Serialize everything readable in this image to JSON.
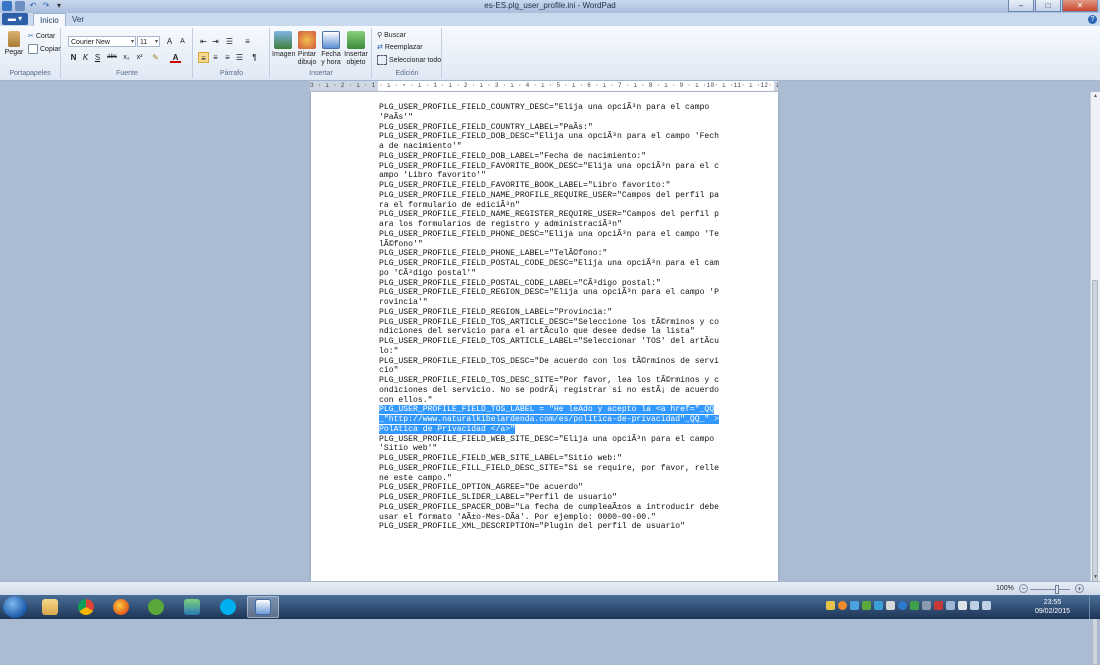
{
  "window": {
    "title": "es-ES.plg_user_profile.ini - WordPad",
    "min_label": "–",
    "max_label": "□",
    "close_label": "✕"
  },
  "ribbon": {
    "app_menu_label": "▬ ▾",
    "tabs": [
      {
        "label": "Inicio",
        "active": true
      },
      {
        "label": "Ver",
        "active": false
      }
    ],
    "help_label": "?",
    "clipboard": {
      "paste_label": "Pegar",
      "cut_label": "Cortar",
      "copy_label": "Copiar",
      "group_label": "Portapapeles"
    },
    "font": {
      "family": "Courier New",
      "size": "11",
      "grow_label": "A",
      "shrink_label": "A",
      "bold": "N",
      "italic": "K",
      "underline": "S",
      "strike": "abc",
      "subscript": "x₂",
      "superscript": "x²",
      "highlight_label": "✎",
      "color_label": "A",
      "group_label": "Fuente"
    },
    "paragraph": {
      "group_label": "Párrafo"
    },
    "insert": {
      "image_label": "Imagen",
      "paint_label": "Pintar dibujo",
      "datetime_label": "Fecha y hora",
      "object_label": "Insertar objeto",
      "group_label": "Insertar"
    },
    "edit": {
      "find_label": "Buscar",
      "replace_label": "Reemplazar",
      "select_all_label": "Seleccionar todo",
      "group_label": "Edición"
    }
  },
  "ruler": {
    "labels": "3 · ı · 2 · ı · 1 · ı · ▿ · ı · 1 · ı · 2 · ı · 3 · ı · 4 · ı · 5 · ı · 6 · ı · 7 · ı · 8 · ı · 9 · ı ·10· ı ·11· ı ·12· ı ·13· ı ·14·ı ·15· ı ·16· ı ·17· ı ·18"
  },
  "document": {
    "before_selection": "PLG_USER_PROFILE_FIELD_COUNTRY_DESC=\"Elija una opciÃ³n para el campo 'PaÃ­s'\"\nPLG_USER_PROFILE_FIELD_COUNTRY_LABEL=\"PaÃ­s:\"\nPLG_USER_PROFILE_FIELD_DOB_DESC=\"Elija una opciÃ³n para el campo 'Fecha de nacimiento'\"\nPLG_USER_PROFILE_FIELD_DOB_LABEL=\"Fecha de nacimiento:\"\nPLG_USER_PROFILE_FIELD_FAVORITE_BOOK_DESC=\"Elija una opciÃ³n para el campo 'Libro favorito'\"\nPLG_USER_PROFILE_FIELD_FAVORITE_BOOK_LABEL=\"Libro favorito:\"\nPLG_USER_PROFILE_FIELD_NAME_PROFILE_REQUIRE_USER=\"Campos del perfil para el formulario de ediciÃ³n\"\nPLG_USER_PROFILE_FIELD_NAME_REGISTER_REQUIRE_USER=\"Campos del perfil para los formularios de registro y administraciÃ³n\"\nPLG_USER_PROFILE_FIELD_PHONE_DESC=\"Elija una opciÃ³n para el campo 'TelÃ©fono'\"\nPLG_USER_PROFILE_FIELD_PHONE_LABEL=\"TelÃ©fono:\"\nPLG_USER_PROFILE_FIELD_POSTAL_CODE_DESC=\"Elija una opciÃ³n para el campo 'CÃ³digo postal'\"\nPLG_USER_PROFILE_FIELD_POSTAL_CODE_LABEL=\"CÃ³digo postal:\"\nPLG_USER_PROFILE_FIELD_REGION_DESC=\"Elija una opciÃ³n para el campo 'Provincia'\"\nPLG_USER_PROFILE_FIELD_REGION_LABEL=\"Provincia:\"\nPLG_USER_PROFILE_FIELD_TOS_ARTICLE_DESC=\"Seleccione los tÃ©rminos y condiciones del servicio para el artÃ­culo que desee dedse la lista\"\nPLG_USER_PROFILE_FIELD_TOS_ARTICLE_LABEL=\"Seleccionar 'TOS' del artÃ­culo:\"\nPLG_USER_PROFILE_FIELD_TOS_DESC=\"De acuerdo con los tÃ©rminos de servicio\"\nPLG_USER_PROFILE_FIELD_TOS_DESC_SITE=\"Por favor, lea los tÃ©rminos y condiciones del servicio. No se podrÃ¡ registrar si no estÃ¡ de acuerdo con ellos.\"\n",
    "selection": "PLG_USER_PROFILE_FIELD_TOS_LABEL = \"He leÃ­do y acepto la <a href=\"_QQ_\"http://www.naturalkibelardenda.com/es/politica-de-privacidad\"_QQ_\" >PolÃ­tica de Privacidad </a>\"",
    "after_selection": "\nPLG_USER_PROFILE_FIELD_WEB_SITE_DESC=\"Elija una opciÃ³n para el campo 'Sitio web'\"\nPLG_USER_PROFILE_FIELD_WEB_SITE_LABEL=\"Sitio web:\"\nPLG_USER_PROFILE_FILL_FIELD_DESC_SITE=\"Si se require, por favor, rellene este campo.\"\nPLG_USER_PROFILE_OPTION_AGREE=\"De acuerdo\"\nPLG_USER_PROFILE_SLIDER_LABEL=\"Perfil de usuario\"\nPLG_USER_PROFILE_SPACER_DOB=\"La fecha de cumpleaÃ±os a introducir debe usar el formato 'AÃ±o-Mes-DÃ­a'. Por ejemplo: 0000-00-00.\"\nPLG_USER_PROFILE_XML_DESCRIPTION=\"Plugin del perfil de usuario\""
  },
  "statusbar": {
    "zoom": "100%",
    "zoom_minus": "−",
    "zoom_plus": "+"
  },
  "taskbar": {
    "time": "23:55",
    "date": "09/02/2015",
    "apps": [
      "file-explorer",
      "chrome",
      "firefox",
      "utorrent",
      "network-tool",
      "skype",
      "wordpad"
    ]
  },
  "colors": {
    "selection": "#3399ff",
    "workspace": "#abbbd1",
    "taskbar": "#1d3556"
  }
}
